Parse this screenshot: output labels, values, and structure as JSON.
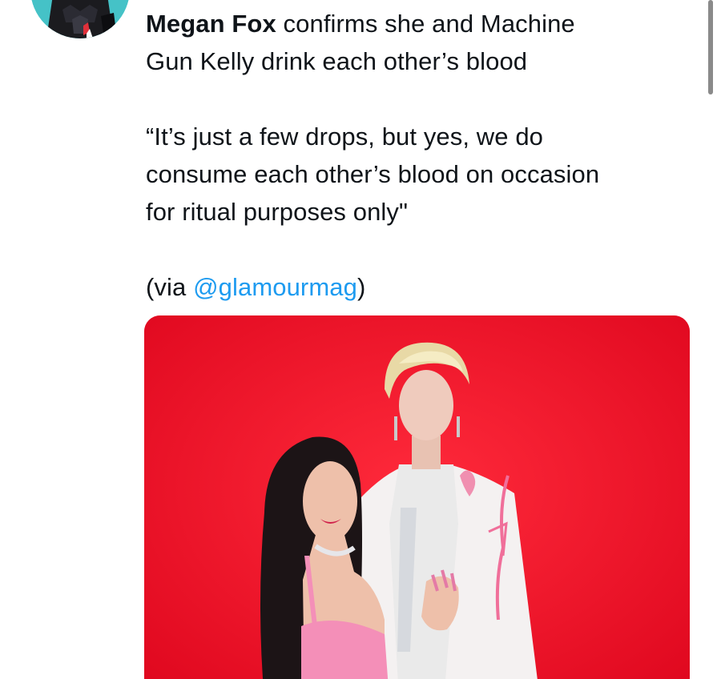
{
  "tweet": {
    "author_bold": "Megan Fox",
    "line1_rest": "confirms she and Machine",
    "line2": "Gun Kelly drink each other’s blood",
    "quote_line1": "“It’s just a few drops, but yes, we do",
    "quote_line2": "consume each other’s blood on occasion",
    "quote_line3": "for ritual purposes only\"",
    "via_prefix": "(via ",
    "via_mention": "@glamourmag",
    "via_suffix": ")"
  },
  "icons": {
    "avatar": "dark-helmet-avatar",
    "media": "couple-red-background-photo"
  },
  "colors": {
    "text": "#0f1419",
    "mention": "#1d9bf0",
    "photo_background": "#f0152e",
    "avatar_background": "#45c2c7"
  }
}
